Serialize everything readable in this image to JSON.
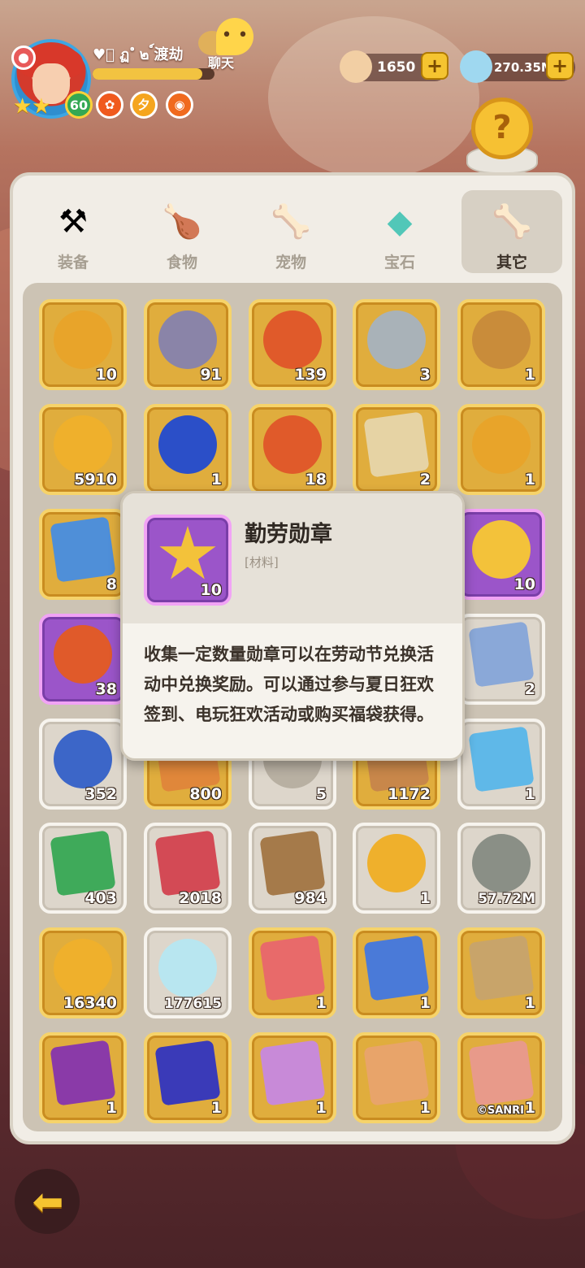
{
  "player": {
    "name": "♥ฺ ฏ ํ ๒ ์渡劫",
    "level": "60",
    "xp_fraction": 0.9
  },
  "chat": {
    "label": "聊天",
    "icon": "chat-bubble-icon"
  },
  "currencies": [
    {
      "icon": "shell-icon",
      "value": "1650",
      "color": "#f2cfa4"
    },
    {
      "icon": "gem-icon",
      "value": "270.35M",
      "color": "#9fd8f0"
    }
  ],
  "help": {
    "icon": "question-coin-icon"
  },
  "tabs": [
    {
      "label": "装备",
      "icon": "hammer-icon",
      "glyph": "⚒"
    },
    {
      "label": "食物",
      "icon": "food-bowl-icon",
      "glyph": "🍗"
    },
    {
      "label": "宠物",
      "icon": "pet-skull-icon",
      "glyph": "🦴"
    },
    {
      "label": "宝石",
      "icon": "gem-tab-icon",
      "glyph": "◆"
    },
    {
      "label": "其它",
      "icon": "bone-icon",
      "glyph": "🦴"
    }
  ],
  "active_tab": 4,
  "items": [
    [
      {
        "count": "10",
        "icon": "coin-cake-icon",
        "style": "gold",
        "color": "#e8a42a"
      },
      {
        "count": "91",
        "icon": "silver-chest-icon",
        "style": "gold",
        "color": "#8a84a8"
      },
      {
        "count": "139",
        "icon": "red-horned-chest-icon",
        "style": "gold",
        "color": "#e05a2a"
      },
      {
        "count": "3",
        "icon": "magnifier-icon",
        "style": "gold",
        "color": "#a9b2b8"
      },
      {
        "count": "1",
        "icon": "emblem-icon",
        "style": "gold",
        "color": "#c98c3a"
      }
    ],
    [
      {
        "count": "5910",
        "icon": "spiral-coin-icon",
        "style": "gold",
        "color": "#efb02c"
      },
      {
        "count": "1",
        "icon": "hero-token-icon",
        "style": "gold",
        "color": "#2b4fc8"
      },
      {
        "count": "18",
        "icon": "red-horned-chest-icon",
        "style": "gold",
        "color": "#e05a2a"
      },
      {
        "count": "2",
        "icon": "map-scroll-icon",
        "style": "gold",
        "color": "#e6d3a4"
      },
      {
        "count": "1",
        "icon": "medal-coin-icon",
        "style": "gold",
        "color": "#e8a42a"
      }
    ],
    [
      {
        "count": "8",
        "icon": "blue-ticket-icon",
        "style": "gold",
        "color": "#4f8fd8"
      },
      null,
      null,
      null,
      {
        "count": "10",
        "icon": "star-badge-icon",
        "style": "purple",
        "color": "#f3c23a"
      }
    ],
    [
      {
        "count": "38",
        "icon": "red-horned-chest-icon",
        "style": "purple",
        "color": "#e05a2a"
      },
      null,
      null,
      null,
      {
        "count": "2",
        "icon": "figure-card-icon",
        "style": "white",
        "color": "#8aa8d8"
      }
    ],
    [
      {
        "count": "352",
        "icon": "blue-crystal-icon",
        "style": "white",
        "color": "#3c66c8"
      },
      {
        "count": "800",
        "icon": "orange-scroll-icon",
        "style": "gold",
        "color": "#e0873a"
      },
      {
        "count": "5",
        "icon": "stone-tablet-icon",
        "style": "white",
        "color": "#b8b0a2"
      },
      {
        "count": "1172",
        "icon": "brown-ticket-icon",
        "style": "gold",
        "color": "#c8874a"
      },
      {
        "count": "1",
        "icon": "blue-card-icon",
        "style": "white",
        "color": "#5fb8e8"
      }
    ],
    [
      {
        "count": "403",
        "icon": "green-ticket-icon",
        "style": "white",
        "color": "#3faa5a"
      },
      {
        "count": "2018",
        "icon": "red-ticket-icon",
        "style": "white",
        "color": "#d34a55"
      },
      {
        "count": "984",
        "icon": "play-ticket-icon",
        "style": "white",
        "color": "#a57a4a"
      },
      {
        "count": "1",
        "icon": "shell-coin-icon",
        "style": "white",
        "color": "#efb02c"
      },
      {
        "count": "57.72M",
        "icon": "rune-stone-icon",
        "style": "white",
        "color": "#8a8f86"
      }
    ],
    [
      {
        "count": "16340",
        "icon": "rune-coin-icon",
        "style": "gold",
        "color": "#efb02c"
      },
      {
        "count": "177615",
        "icon": "rainbow-crystal-icon",
        "style": "white",
        "color": "#b8e6f0"
      },
      {
        "count": "1",
        "icon": "photo-card-icon",
        "style": "gold",
        "color": "#e86a6a"
      },
      {
        "count": "1",
        "icon": "photo-card-icon",
        "style": "gold",
        "color": "#4a7ad8"
      },
      {
        "count": "1",
        "icon": "photo-card-icon",
        "style": "gold",
        "color": "#c8a46a"
      }
    ],
    [
      {
        "count": "1",
        "icon": "photo-card-icon",
        "style": "gold",
        "color": "#8a3aa8"
      },
      {
        "count": "1",
        "icon": "photo-card-icon",
        "style": "gold",
        "color": "#3a3ab8"
      },
      {
        "count": "1",
        "icon": "photo-card-icon",
        "style": "gold",
        "color": "#c88ad8"
      },
      {
        "count": "1",
        "icon": "photo-card-icon",
        "style": "gold",
        "color": "#e8a46a"
      },
      {
        "count": "1",
        "icon": "photo-card-icon",
        "style": "gold",
        "color": "#e89a8a",
        "watermark": "©SANRI"
      }
    ]
  ],
  "tooltip": {
    "title": "勤劳勋章",
    "category": "[材料]",
    "count": "10",
    "description": "收集一定数量勋章可以在劳动节兑换活动中兑换奖励。可以通过参与夏日狂欢签到、电玩狂欢活动或购买福袋获得。"
  },
  "back": {
    "icon": "back-arrow-icon"
  }
}
